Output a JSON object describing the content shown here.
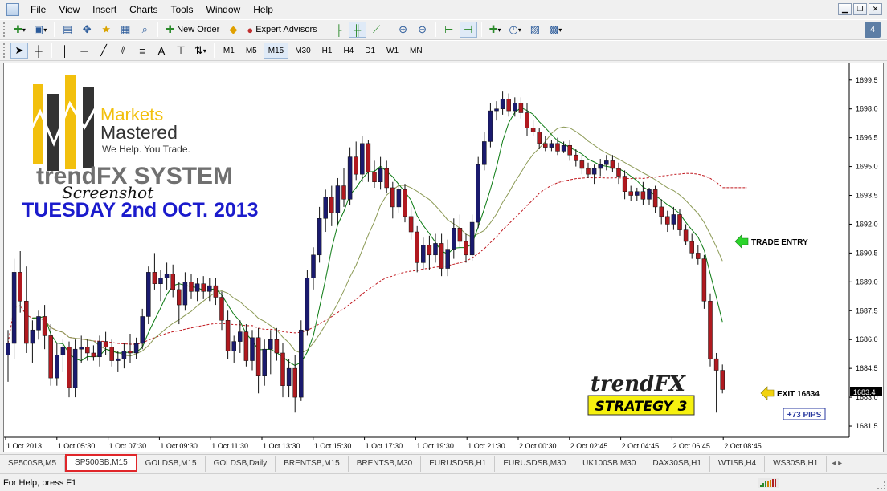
{
  "menu": [
    "File",
    "View",
    "Insert",
    "Charts",
    "Tools",
    "Window",
    "Help"
  ],
  "toolbar": {
    "new_order": "New Order",
    "expert_advisors": "Expert Advisors",
    "timeframes": [
      "M1",
      "M5",
      "M15",
      "M30",
      "H1",
      "H4",
      "D1",
      "W1",
      "MN"
    ],
    "active_timeframe": "M15"
  },
  "help_badge": "4",
  "overlay": {
    "brand_line1": "Markets",
    "brand_line2": "Mastered",
    "tagline": "We Help. You Trade.",
    "system": "trendFX SYSTEM",
    "screenshot": "Screenshot",
    "date": "TUESDAY 2nd OCT. 2013",
    "trade_entry": "TRADE ENTRY",
    "exit": "EXIT 16834",
    "pips": "+73 PIPS",
    "strategy_brand": "trendFX",
    "strategy": "STRATEGY 3",
    "current_price": "1683.4"
  },
  "chart_data": {
    "type": "candlestick",
    "symbol": "SP500SB",
    "timeframe": "M15",
    "y_ticks": [
      "1699.5",
      "1698.0",
      "1696.5",
      "1695.0",
      "1693.5",
      "1692.0",
      "1690.5",
      "1689.0",
      "1687.5",
      "1686.0",
      "1684.5",
      "1683.0",
      "1681.5"
    ],
    "ylim": [
      1681.0,
      1700.2
    ],
    "x_ticks": [
      "1 Oct 2013",
      "1 Oct 05:30",
      "1 Oct 07:30",
      "1 Oct 09:30",
      "1 Oct 11:30",
      "1 Oct 13:30",
      "1 Oct 15:30",
      "1 Oct 17:30",
      "1 Oct 19:30",
      "1 Oct 21:30",
      "2 Oct 00:30",
      "2 Oct 02:45",
      "2 Oct 04:45",
      "2 Oct 06:45",
      "2 Oct 08:45"
    ],
    "candles": [
      [
        1685.2,
        1686.5,
        1683.8,
        1685.8
      ],
      [
        1685.8,
        1690.2,
        1685.0,
        1689.5
      ],
      [
        1689.5,
        1690.6,
        1687.4,
        1688.0
      ],
      [
        1688.0,
        1689.8,
        1685.3,
        1685.8
      ],
      [
        1685.8,
        1687.0,
        1684.8,
        1686.5
      ],
      [
        1686.5,
        1687.5,
        1686.0,
        1687.2
      ],
      [
        1687.2,
        1687.8,
        1685.5,
        1686.2
      ],
      [
        1686.2,
        1686.8,
        1683.6,
        1684.0
      ],
      [
        1684.0,
        1685.8,
        1683.6,
        1685.2
      ],
      [
        1685.2,
        1686.0,
        1684.3,
        1685.6
      ],
      [
        1685.6,
        1685.9,
        1683.0,
        1683.5
      ],
      [
        1683.5,
        1686.0,
        1683.0,
        1685.5
      ],
      [
        1685.5,
        1686.2,
        1684.8,
        1685.6
      ],
      [
        1685.6,
        1686.0,
        1684.9,
        1685.3
      ],
      [
        1685.3,
        1685.7,
        1684.9,
        1685.1
      ],
      [
        1685.1,
        1686.2,
        1684.6,
        1685.9
      ],
      [
        1685.9,
        1686.4,
        1685.2,
        1685.6
      ],
      [
        1685.6,
        1686.0,
        1684.6,
        1684.9
      ],
      [
        1684.9,
        1685.4,
        1684.3,
        1685.0
      ],
      [
        1685.0,
        1685.8,
        1684.5,
        1685.4
      ],
      [
        1685.4,
        1686.3,
        1684.8,
        1685.3
      ],
      [
        1685.3,
        1686.1,
        1685.0,
        1685.8
      ],
      [
        1685.8,
        1687.6,
        1685.5,
        1687.2
      ],
      [
        1687.2,
        1689.8,
        1686.8,
        1689.5
      ],
      [
        1689.5,
        1690.5,
        1688.6,
        1688.9
      ],
      [
        1688.9,
        1689.6,
        1688.0,
        1689.2
      ],
      [
        1689.2,
        1690.0,
        1688.6,
        1689.4
      ],
      [
        1689.4,
        1689.9,
        1688.2,
        1688.6
      ],
      [
        1688.6,
        1689.0,
        1686.8,
        1687.8
      ],
      [
        1687.8,
        1689.5,
        1687.5,
        1689.0
      ],
      [
        1689.0,
        1689.4,
        1688.1,
        1688.5
      ],
      [
        1688.5,
        1689.2,
        1688.0,
        1688.9
      ],
      [
        1688.9,
        1689.3,
        1688.1,
        1688.5
      ],
      [
        1688.5,
        1689.2,
        1688.0,
        1688.8
      ],
      [
        1688.8,
        1689.2,
        1687.8,
        1688.2
      ],
      [
        1688.2,
        1688.5,
        1686.5,
        1687.0
      ],
      [
        1687.0,
        1687.5,
        1685.0,
        1685.4
      ],
      [
        1685.4,
        1686.2,
        1684.8,
        1685.9
      ],
      [
        1685.9,
        1687.0,
        1685.3,
        1686.4
      ],
      [
        1686.4,
        1686.8,
        1684.6,
        1684.9
      ],
      [
        1684.9,
        1686.5,
        1684.4,
        1686.1
      ],
      [
        1686.1,
        1686.6,
        1683.2,
        1684.1
      ],
      [
        1684.1,
        1686.0,
        1683.6,
        1685.5
      ],
      [
        1685.5,
        1686.5,
        1684.2,
        1686.0
      ],
      [
        1686.0,
        1686.6,
        1684.9,
        1685.3
      ],
      [
        1685.3,
        1685.8,
        1683.0,
        1683.6
      ],
      [
        1683.6,
        1685.0,
        1683.0,
        1684.5
      ],
      [
        1684.5,
        1685.2,
        1682.2,
        1683.0
      ],
      [
        1683.0,
        1687.0,
        1682.8,
        1686.5
      ],
      [
        1686.5,
        1689.6,
        1686.2,
        1689.2
      ],
      [
        1689.2,
        1690.8,
        1688.6,
        1690.4
      ],
      [
        1690.4,
        1692.9,
        1690.0,
        1692.3
      ],
      [
        1692.3,
        1693.8,
        1691.6,
        1693.4
      ],
      [
        1693.4,
        1694.0,
        1691.9,
        1692.6
      ],
      [
        1692.6,
        1694.4,
        1692.0,
        1694.0
      ],
      [
        1694.0,
        1694.9,
        1692.9,
        1693.3
      ],
      [
        1693.3,
        1696.0,
        1693.0,
        1695.5
      ],
      [
        1695.5,
        1696.3,
        1694.3,
        1694.6
      ],
      [
        1694.6,
        1696.6,
        1694.2,
        1696.2
      ],
      [
        1696.2,
        1696.4,
        1694.2,
        1694.7
      ],
      [
        1694.7,
        1695.3,
        1693.9,
        1694.2
      ],
      [
        1694.2,
        1695.5,
        1693.8,
        1694.9
      ],
      [
        1694.9,
        1695.3,
        1693.6,
        1693.9
      ],
      [
        1693.9,
        1694.2,
        1692.3,
        1692.9
      ],
      [
        1692.9,
        1694.0,
        1692.6,
        1693.8
      ],
      [
        1693.8,
        1694.1,
        1692.1,
        1692.4
      ],
      [
        1692.4,
        1692.9,
        1691.2,
        1691.6
      ],
      [
        1691.6,
        1691.9,
        1689.5,
        1690.0
      ],
      [
        1690.0,
        1691.3,
        1689.6,
        1690.9
      ],
      [
        1690.9,
        1691.4,
        1689.6,
        1690.4
      ],
      [
        1690.4,
        1691.5,
        1690.0,
        1691.0
      ],
      [
        1691.0,
        1691.5,
        1689.3,
        1689.7
      ],
      [
        1689.7,
        1691.2,
        1689.3,
        1690.7
      ],
      [
        1690.7,
        1692.3,
        1690.2,
        1691.8
      ],
      [
        1691.8,
        1692.5,
        1690.8,
        1691.1
      ],
      [
        1691.1,
        1691.5,
        1690.0,
        1690.4
      ],
      [
        1690.4,
        1692.5,
        1690.1,
        1692.1
      ],
      [
        1692.1,
        1695.5,
        1691.8,
        1695.1
      ],
      [
        1695.1,
        1696.8,
        1694.8,
        1696.3
      ],
      [
        1696.3,
        1698.3,
        1696.0,
        1697.9
      ],
      [
        1697.9,
        1698.4,
        1697.4,
        1698.0
      ],
      [
        1698.0,
        1698.9,
        1697.7,
        1698.5
      ],
      [
        1698.5,
        1698.8,
        1697.6,
        1697.9
      ],
      [
        1697.9,
        1698.6,
        1697.6,
        1698.3
      ],
      [
        1698.3,
        1698.6,
        1697.5,
        1697.8
      ],
      [
        1697.8,
        1698.3,
        1696.6,
        1697.0
      ],
      [
        1697.0,
        1697.4,
        1696.6,
        1696.8
      ],
      [
        1696.8,
        1697.0,
        1695.9,
        1696.2
      ],
      [
        1696.2,
        1696.6,
        1695.8,
        1696.0
      ],
      [
        1696.0,
        1696.4,
        1695.8,
        1696.2
      ],
      [
        1696.2,
        1696.5,
        1695.6,
        1695.8
      ],
      [
        1695.8,
        1696.3,
        1695.7,
        1696.1
      ],
      [
        1696.1,
        1696.4,
        1695.3,
        1695.6
      ],
      [
        1695.6,
        1695.9,
        1695.0,
        1695.3
      ],
      [
        1695.3,
        1695.6,
        1694.6,
        1694.9
      ],
      [
        1694.9,
        1695.2,
        1694.4,
        1694.6
      ],
      [
        1694.6,
        1695.1,
        1694.1,
        1694.9
      ],
      [
        1694.9,
        1695.4,
        1694.5,
        1695.1
      ],
      [
        1695.1,
        1695.6,
        1694.8,
        1695.3
      ],
      [
        1695.3,
        1695.6,
        1694.7,
        1694.9
      ],
      [
        1694.9,
        1695.2,
        1694.1,
        1694.5
      ],
      [
        1694.5,
        1694.8,
        1693.3,
        1693.7
      ],
      [
        1693.7,
        1694.0,
        1693.2,
        1693.5
      ],
      [
        1693.5,
        1693.9,
        1693.2,
        1693.7
      ],
      [
        1693.7,
        1694.2,
        1693.0,
        1693.3
      ],
      [
        1693.3,
        1693.9,
        1693.0,
        1693.8
      ],
      [
        1693.8,
        1694.0,
        1692.6,
        1692.9
      ],
      [
        1692.9,
        1693.3,
        1692.0,
        1692.4
      ],
      [
        1692.4,
        1692.7,
        1691.6,
        1692.0
      ],
      [
        1692.0,
        1692.9,
        1691.7,
        1692.5
      ],
      [
        1692.5,
        1692.8,
        1691.4,
        1691.7
      ],
      [
        1691.7,
        1692.0,
        1690.9,
        1691.1
      ],
      [
        1691.1,
        1691.5,
        1690.2,
        1690.5
      ],
      [
        1690.5,
        1690.9,
        1689.9,
        1690.2
      ],
      [
        1690.2,
        1690.4,
        1687.6,
        1688.0
      ],
      [
        1688.0,
        1688.4,
        1684.6,
        1685.0
      ],
      [
        1685.0,
        1685.3,
        1682.2,
        1684.4
      ],
      [
        1684.4,
        1684.7,
        1683.2,
        1683.4
      ]
    ],
    "candle_colors": {
      "up": "#1a1a6e",
      "down": "#b0191f"
    },
    "ma_fast_color": "#0b7a12",
    "ma_mid_color": "#8c9a56",
    "ma_slow_color": "#c0191f"
  },
  "tabs": [
    "SP500SB,M5",
    "SP500SB,M15",
    "GOLDSB,M15",
    "GOLDSB,Daily",
    "BRENTSB,M15",
    "BRENTSB,M30",
    "EURUSDSB,H1",
    "EURUSDSB,M30",
    "UK100SB,M30",
    "DAX30SB,H1",
    "WTISB,H4",
    "WS30SB,H1"
  ],
  "active_tab": "SP500SB,M15",
  "status": {
    "help_text": "For Help, press F1",
    "traffic": ""
  }
}
